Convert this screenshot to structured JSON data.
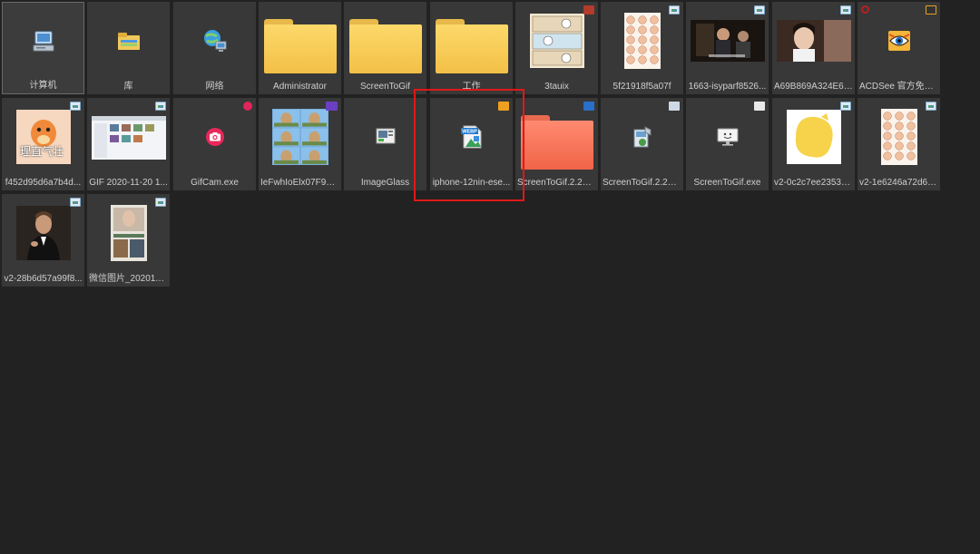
{
  "window": {
    "background": "#222222",
    "tile_color": "#383838"
  },
  "highlight": {
    "color": "#e01818",
    "target": "iphone-12nin-ese..."
  },
  "items": [
    {
      "label": "计算机",
      "icon": "computer-icon",
      "type": "system",
      "badge": null,
      "selected": true
    },
    {
      "label": "库",
      "icon": "library-icon",
      "type": "system",
      "badge": null
    },
    {
      "label": "网络",
      "icon": "network-icon",
      "type": "system",
      "badge": null
    },
    {
      "label": "Administrator",
      "icon": "folder-icon",
      "type": "folder",
      "badge": null
    },
    {
      "label": "ScreenToGif",
      "icon": "folder-icon",
      "type": "folder",
      "badge": null
    },
    {
      "label": "工作",
      "icon": "folder-icon",
      "type": "folder",
      "badge": null
    },
    {
      "label": "3tauix",
      "icon": "comic-thumbnail",
      "type": "file",
      "badge": "red"
    },
    {
      "label": "5f21918f5a07f",
      "icon": "sticker-sheet-thumbnail",
      "type": "file",
      "badge": "img"
    },
    {
      "label": "1663-isyparf8526...",
      "icon": "movie-still-thumbnail",
      "type": "file",
      "badge": "img"
    },
    {
      "label": "A69B869A324E6E...",
      "icon": "portrait-thumbnail",
      "type": "file",
      "badge": "img"
    },
    {
      "label": "ACDSee 官方免费版",
      "icon": "acdsee-eye-icon",
      "type": "app",
      "badge": "acd"
    },
    {
      "label": "f452d95d6a7b4d...",
      "icon": "charmander-thumbnail",
      "type": "file",
      "badge": "img"
    },
    {
      "label": "GIF 2020-11-20 1...",
      "icon": "screenshot-thumbnail",
      "type": "file",
      "badge": "img"
    },
    {
      "label": "GifCam.exe",
      "icon": "camera-icon",
      "type": "app",
      "badge": "cam"
    },
    {
      "label": "IeFwhIoElx07F93V...",
      "icon": "llama-grid-thumbnail",
      "type": "file",
      "badge": "mp4"
    },
    {
      "label": "ImageGlass",
      "icon": "imageglass-icon",
      "type": "app",
      "badge": null
    },
    {
      "label": "iphone-12nin-ese...",
      "icon": "webp-file-icon",
      "type": "file",
      "badge": "webp"
    },
    {
      "label": "ScreenToGif.2.27....",
      "icon": "folder-icon",
      "type": "folder-red",
      "badge": "zip"
    },
    {
      "label": "ScreenToGif.2.27....",
      "icon": "installer-icon",
      "type": "app",
      "badge": "inst"
    },
    {
      "label": "ScreenToGif.exe",
      "icon": "monitor-icon",
      "type": "app",
      "badge": "exe"
    },
    {
      "label": "v2-0c2c7ee23536...",
      "icon": "yellow-blob-thumbnail",
      "type": "file",
      "badge": "img"
    },
    {
      "label": "v2-1e6246a72d62...",
      "icon": "sticker-sheet-thumbnail",
      "type": "file",
      "badge": "img"
    },
    {
      "label": "v2-28b6d57a99f8...",
      "icon": "man-in-suit-thumbnail",
      "type": "file",
      "badge": "img"
    },
    {
      "label": "微信图片_2020110...",
      "icon": "magazine-thumbnail",
      "type": "file",
      "badge": "img"
    }
  ],
  "thumb_text": {
    "charmander_caption": "理直气壮"
  }
}
